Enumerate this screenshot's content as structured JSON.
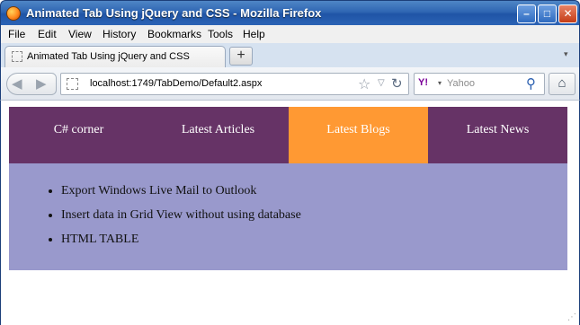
{
  "window": {
    "title": "Animated Tab Using jQuery and CSS - Mozilla Firefox",
    "controls": {
      "minimize": "–",
      "maximize": "□",
      "close": "✕"
    }
  },
  "menubar": {
    "items": [
      {
        "label": "File"
      },
      {
        "label": "Edit"
      },
      {
        "label": "View"
      },
      {
        "label": "History"
      },
      {
        "label": "Bookmarks"
      },
      {
        "label": "Tools"
      },
      {
        "label": "Help"
      }
    ]
  },
  "tabs": {
    "active_tab_title": "Animated Tab Using jQuery and CSS",
    "new_tab_symbol": "+",
    "list_tabs_symbol": "▾"
  },
  "navbar": {
    "back_symbol": "◀",
    "forward_symbol": "▶",
    "url": "localhost:1749/TabDemo/Default2.aspx",
    "bookmark_symbol": "☆",
    "dropdown_symbol": "▽",
    "reload_symbol": "↻",
    "search_engine_symbol": "Y!",
    "search_dropdown_symbol": "▾",
    "search_placeholder": "Yahoo",
    "search_symbol": "⚲",
    "home_symbol": "⌂"
  },
  "page": {
    "tabs": [
      {
        "label": "C# corner",
        "active": false
      },
      {
        "label": "Latest Articles",
        "active": false
      },
      {
        "label": "Latest Blogs",
        "active": true
      },
      {
        "label": "News",
        "active": false
      }
    ],
    "panel_items": [
      "Export Windows Live Mail to Outlook",
      "Insert data in Grid View without using database",
      "HTML TABLE"
    ]
  },
  "colors": {
    "tab_row": "#663366",
    "active_tab": "#ff9933",
    "panel": "#9999cc"
  }
}
